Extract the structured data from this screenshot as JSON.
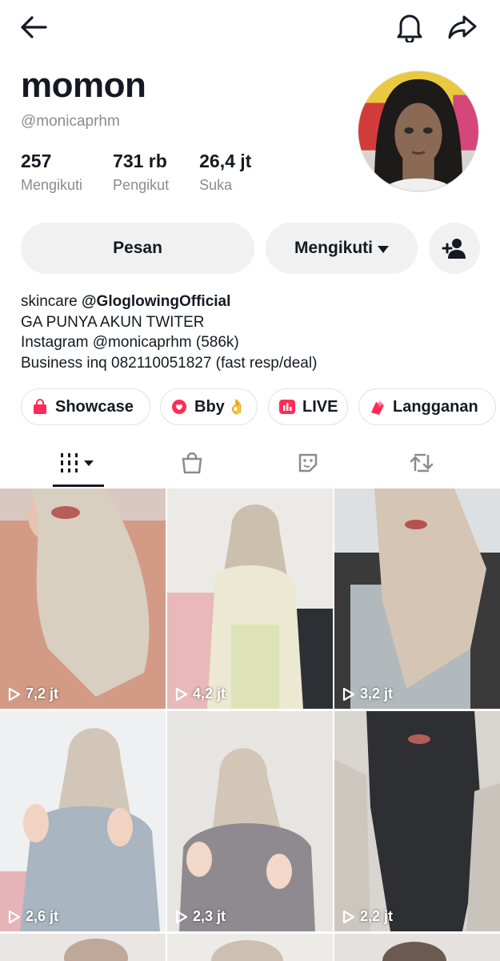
{
  "profile": {
    "display_name": "momon",
    "handle": "@monicaprhm"
  },
  "stats": [
    {
      "value": "257",
      "label": "Mengikuti"
    },
    {
      "value": "731 rb",
      "label": "Pengikut"
    },
    {
      "value": "26,4 jt",
      "label": "Suka"
    }
  ],
  "actions": {
    "message_label": "Pesan",
    "following_label": "Mengikuti"
  },
  "bio": {
    "line1_prefix": "skincare ",
    "line1_mention": "@GloglowingOfficial",
    "line2": "GA PUNYA AKUN TWITER",
    "line3": "Instagram @monicaprhm (586k)",
    "line4": "Business inq 082110051827 (fast resp/deal)"
  },
  "chips": [
    {
      "label": "Showcase",
      "icon": "shopping-bag-icon"
    },
    {
      "label": "Bby",
      "icon": "heart-chat-icon"
    },
    {
      "label": "LIVE",
      "icon": "live-bars-icon"
    },
    {
      "label": "Langganan",
      "icon": "subscription-icon"
    }
  ],
  "videos": [
    {
      "views": "7,2 jt"
    },
    {
      "views": "4,2 jt"
    },
    {
      "views": "3,2 jt"
    },
    {
      "views": "2,6 jt"
    },
    {
      "views": "2,3 jt"
    },
    {
      "views": "2,2 jt"
    }
  ],
  "colors": {
    "accent": "#fe2c55",
    "button_bg": "#f1f1f2",
    "secondary_text": "#8a8b91"
  }
}
